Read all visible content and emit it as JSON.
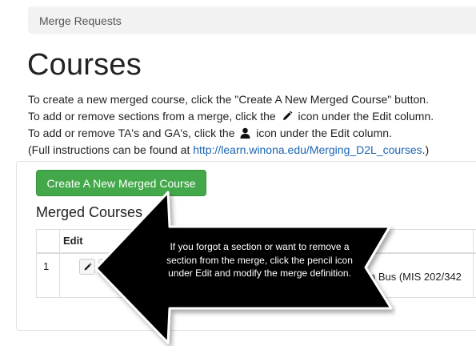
{
  "breadcrumb": {
    "label": "Merge Requests"
  },
  "page": {
    "title": "Courses"
  },
  "instructions": {
    "line1": "To create a new merged course, click the \"Create A New Merged Course\" button.",
    "line2_before": "To add or remove sections from a merge, click the",
    "line2_icon": "pencil-icon",
    "line2_after": "icon under the Edit column.",
    "line3_before": "To add or remove TA's and GA's, click the",
    "line3_icon": "user-icon",
    "line3_after": "icon under the Edit column.",
    "line4_before": "(Full instructions can be found at",
    "line4_link": "http://learn.winona.edu/Merging_D2L_courses",
    "line4_after": ".)"
  },
  "actions": {
    "create_label": "Create A New Merged Course"
  },
  "merged_courses": {
    "title": "Merged Courses",
    "columns": [
      "",
      "Edit"
    ],
    "rows": [
      {
        "num": "1",
        "course": "n Bus (MIS 202/342"
      }
    ]
  },
  "callout": {
    "text": "If you forgot a section or want to remove a section from the merge, click the pencil icon under Edit and modify the merge definition."
  },
  "colors": {
    "accent_green": "#43a84a",
    "link_blue": "#1a65b4",
    "callout_fill": "#000000"
  }
}
